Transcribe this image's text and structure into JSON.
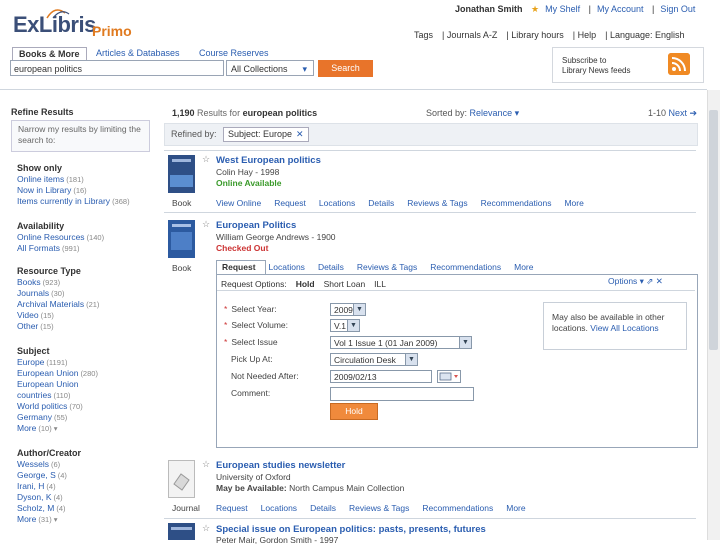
{
  "header": {
    "logo_main": "ExLibris",
    "logo_sub": "Primo",
    "user_links": [
      "Jonathan Smith",
      "My Shelf",
      "My Account",
      "Sign Out"
    ],
    "top_links": [
      "Tags",
      "Journals A-Z",
      "Library hours",
      "Help",
      "Language: English"
    ],
    "tabs": [
      "Books & More",
      "Articles & Databases",
      "Course Reserves"
    ],
    "search_value": "european politics",
    "collection_value": "All Collections",
    "search_button": "Search",
    "rss_text_1": "Subscribe to",
    "rss_text_2": "Library News feeds"
  },
  "sidebar": {
    "title": "Refine Results",
    "hint": "Narrow my results by limiting the search to:",
    "groups": [
      {
        "name": "Show only",
        "items": [
          {
            "label": "Online items",
            "count": "(181)"
          },
          {
            "label": "Now in Library",
            "count": "(16)"
          },
          {
            "label": "Items currently in Library",
            "count": "(368)"
          }
        ]
      },
      {
        "name": "Availability",
        "items": [
          {
            "label": "Online Resources",
            "count": "(140)"
          },
          {
            "label": "All Formats",
            "count": "(991)"
          }
        ]
      },
      {
        "name": "Resource Type",
        "items": [
          {
            "label": "Books",
            "count": "(923)"
          },
          {
            "label": "Journals",
            "count": "(30)"
          },
          {
            "label": "Archival Materials",
            "count": "(21)"
          },
          {
            "label": "Video",
            "count": "(15)"
          },
          {
            "label": "Other",
            "count": "(15)"
          }
        ]
      },
      {
        "name": "Subject",
        "items": [
          {
            "label": "Europe",
            "count": "(1191)"
          },
          {
            "label": "European Union",
            "count": "(280)"
          },
          {
            "label": "European Union",
            "count": ""
          },
          {
            "label": "countries",
            "count": "(110)"
          },
          {
            "label": "World politics",
            "count": "(70)"
          },
          {
            "label": "Germany",
            "count": "(55)"
          },
          {
            "label": "More",
            "count": "(10) ▾"
          }
        ]
      },
      {
        "name": "Author/Creator",
        "items": [
          {
            "label": "Wessels",
            "count": "(6)"
          },
          {
            "label": "George, S",
            "count": "(4)"
          },
          {
            "label": "Irani, H",
            "count": "(4)"
          },
          {
            "label": "Dyson, K",
            "count": "(4)"
          },
          {
            "label": "Scholz, M",
            "count": "(4)"
          },
          {
            "label": "More",
            "count": "(31) ▾"
          }
        ]
      }
    ]
  },
  "results": {
    "count_num": "1,190",
    "count_text": "Results for",
    "count_query": "european politics",
    "sort_label": "Sorted by:",
    "sort_value": "Relevance ▾",
    "pager": "1-10",
    "pager_next": "Next ➔",
    "defined_label": "Refined by:",
    "chip_label": "Subject: Europe",
    "chip_x": "✕"
  },
  "records": [
    {
      "title": "West European politics",
      "author": "Colin Hay - 1998",
      "status": "Online Available",
      "type": "Book",
      "tabs": [
        "View Online",
        "Request",
        "Locations",
        "Details",
        "Reviews & Tags",
        "Recommendations",
        "More"
      ]
    },
    {
      "title": "European Politics",
      "author": "William George Andrews - 1900",
      "status": "Checked Out",
      "type": "Book",
      "tabs": [
        "Request",
        "Locations",
        "Details",
        "Reviews & Tags",
        "Recommendations",
        "More"
      ]
    },
    {
      "title": "European studies newsletter",
      "author": "University of Oxford",
      "status_bold": "May be Available:",
      "status_rest": "North Campus Main Collection",
      "type": "Journal",
      "tabs": [
        "Request",
        "Locations",
        "Details",
        "Reviews & Tags",
        "Recommendations",
        "More"
      ]
    },
    {
      "title": "Special issue on European politics: pasts, presents, futures",
      "author": "Peter Mair, Gordon Smith - 1997"
    }
  ],
  "request_panel": {
    "subtabs": [
      "Request Options:",
      "Hold",
      "Short Loan",
      "ILL"
    ],
    "panel_controls": "Options ▾  ⇗  ✕",
    "fields": [
      {
        "label": "Select Year:",
        "required": true,
        "value": "2009"
      },
      {
        "label": "Select Volume:",
        "required": true,
        "value": "V.1"
      },
      {
        "label": "Select Issue",
        "required": true,
        "value": "Vol 1 Issue 1 (01 Jan 2009)"
      },
      {
        "label": "Pick Up At:",
        "required": false,
        "value": "Circulation Desk"
      },
      {
        "label": "Not Needed After:",
        "required": false,
        "value": "2009/02/13"
      },
      {
        "label": "Comment:",
        "required": false,
        "value": ""
      }
    ],
    "hold_button": "Hold",
    "avail_text": "May also be available in other locations.",
    "avail_link": "View All Locations"
  },
  "colors": {
    "accent": "#e8742a",
    "link": "#2a5db0",
    "online": "#3a9a2a",
    "checked_out": "#cc3333"
  }
}
